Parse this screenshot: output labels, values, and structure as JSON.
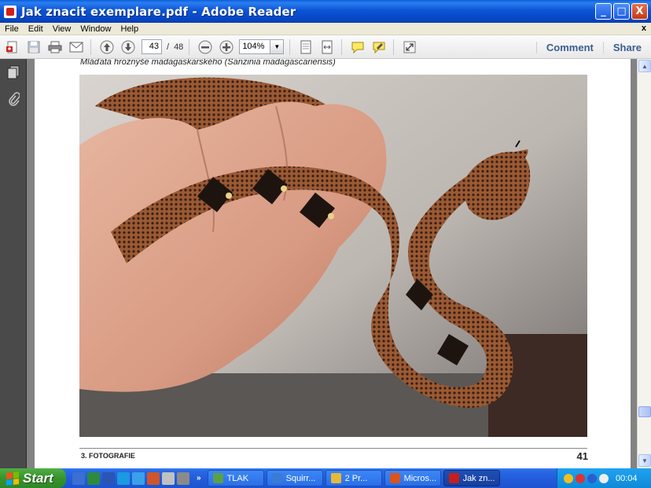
{
  "window": {
    "title": "Jak znacit exemplare.pdf - Adobe Reader",
    "minimize": "_",
    "maximize": "□",
    "close": "X"
  },
  "menu": {
    "items": [
      "File",
      "Edit",
      "View",
      "Window",
      "Help"
    ],
    "close_doc": "x"
  },
  "toolbar": {
    "current_page": "43",
    "page_separator": "/",
    "total_pages": "48",
    "zoom": "104%",
    "comment_label": "Comment",
    "share_label": "Share"
  },
  "document": {
    "caption": "Mláďata hroznýše madagaskarského (Sanzinia madagascariensis)",
    "section": "3. FOTOGRAFIE",
    "page_number": "41"
  },
  "taskbar": {
    "start_label": "Start",
    "quick_chevron": "»",
    "tasks": [
      {
        "label": "TLAK",
        "icon_color": "#5aa04a"
      },
      {
        "label": "Squirr...",
        "icon_color": "#3b7bd6"
      },
      {
        "label": "2 Pr...",
        "icon_color": "#e6b93a"
      },
      {
        "label": "Micros...",
        "icon_color": "#d9541e"
      },
      {
        "label": "Jak zn...",
        "icon_color": "#c41f1f"
      }
    ],
    "clock": "00:04"
  },
  "colors": {
    "titlebar_blue": "#0b55d6",
    "taskbar_blue": "#225ddc",
    "start_green": "#35942c",
    "tray_blue": "#0f8ad9",
    "doc_background": "#838383"
  }
}
